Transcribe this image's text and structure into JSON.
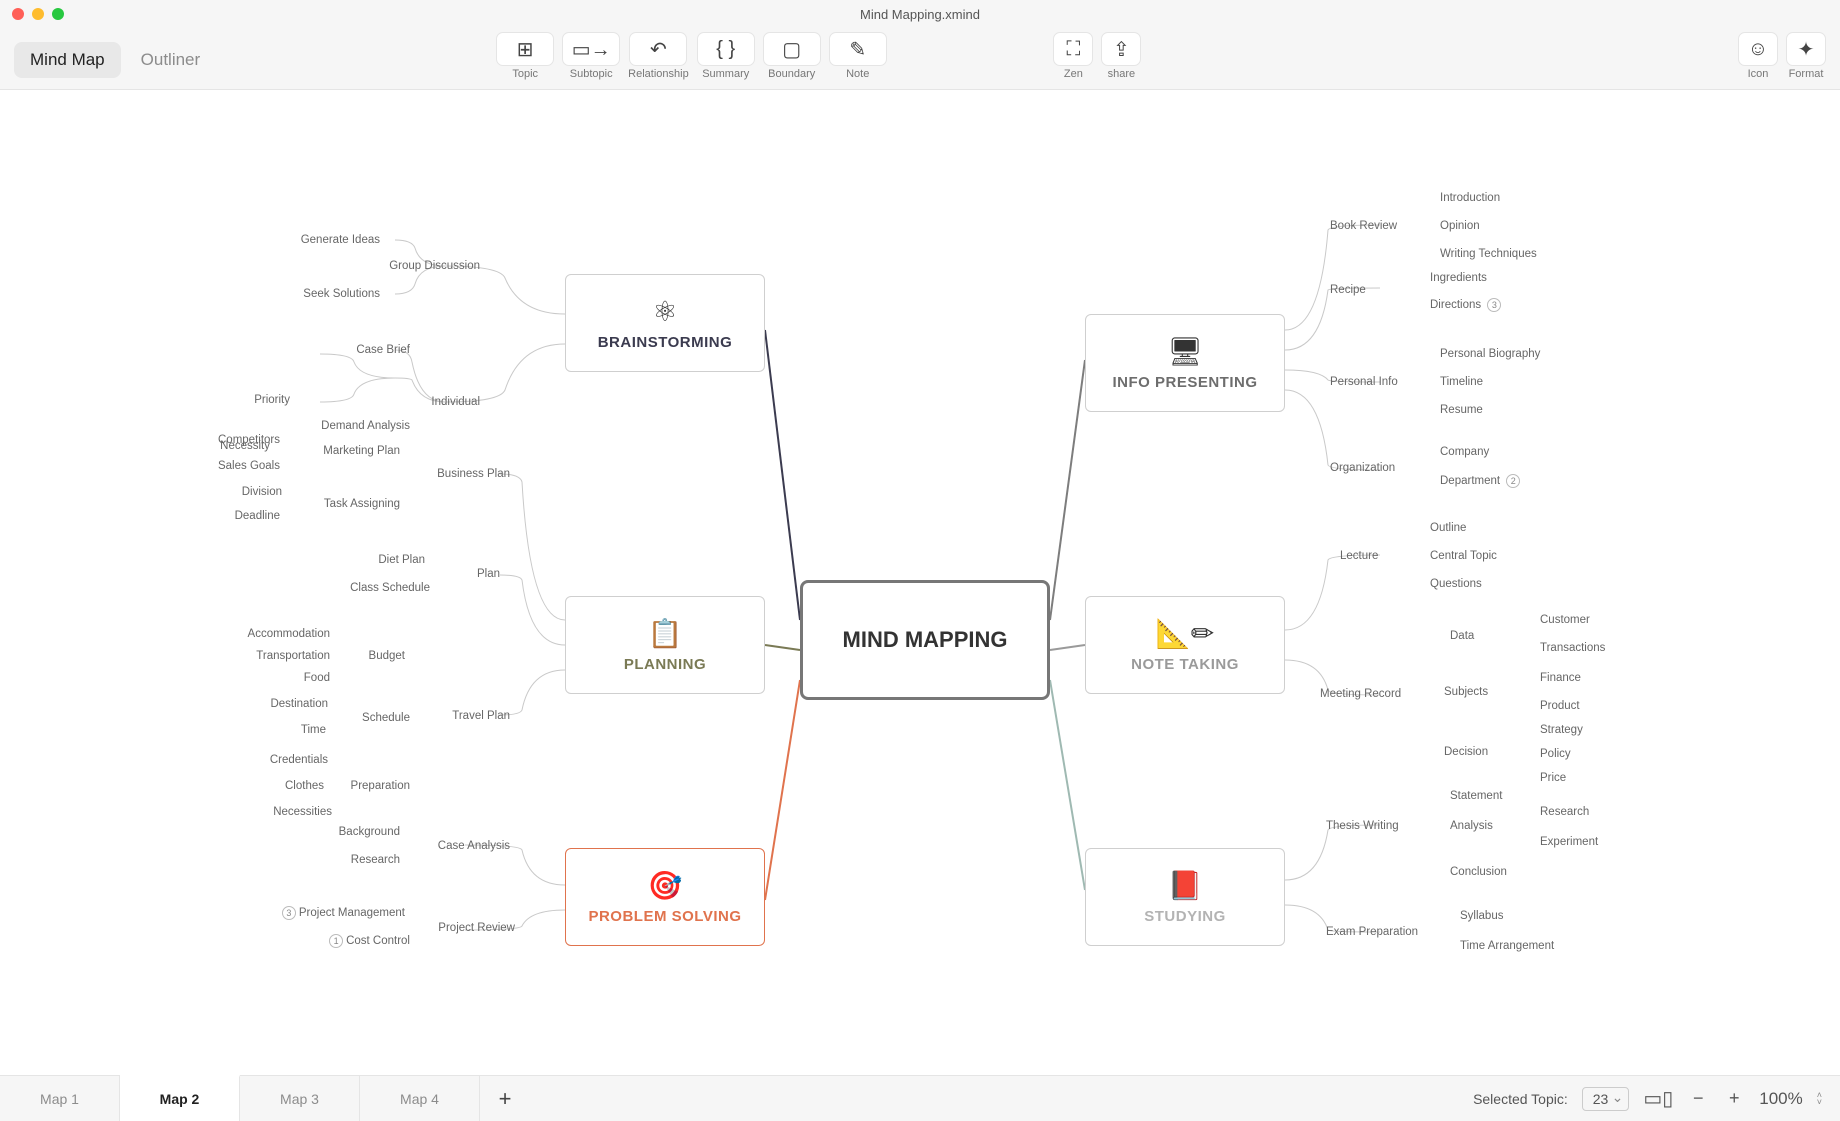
{
  "window": {
    "title": "Mind Mapping.xmind"
  },
  "view_toggle": {
    "mindmap": "Mind Map",
    "outliner": "Outliner",
    "active": "mindmap"
  },
  "toolbar": {
    "topic": "Topic",
    "subtopic": "Subtopic",
    "relationship": "Relationship",
    "summary": "Summary",
    "boundary": "Boundary",
    "note": "Note",
    "zen": "Zen",
    "share": "share",
    "icon": "Icon",
    "format": "Format"
  },
  "central": {
    "title": "MIND MAPPING"
  },
  "branches": {
    "brainstorming": {
      "title": "BRAINSTORMING",
      "color": "#3b3b4f",
      "children": [
        {
          "label": "Group Discussion",
          "children": [
            "Generate Ideas",
            "Seek Solutions"
          ]
        },
        {
          "label": "Individual",
          "children": [
            "Case Brief",
            "Demand Analysis",
            "Priority",
            "Necessity"
          ]
        }
      ]
    },
    "planning": {
      "title": "PLANNING",
      "color": "#7a7a55",
      "children": [
        {
          "label": "Business Plan",
          "children": [
            {
              "label": "Marketing Plan",
              "children": [
                "Competitors",
                "Sales Goals"
              ]
            },
            {
              "label": "Task Assigning",
              "children": [
                "Division",
                "Deadline"
              ]
            }
          ]
        },
        {
          "label": "Plan",
          "children": [
            "Diet Plan",
            "Class Schedule"
          ]
        },
        {
          "label": "Travel Plan",
          "children": [
            {
              "label": "Budget",
              "children": [
                "Accommodation",
                "Transportation",
                "Food"
              ]
            },
            {
              "label": "Schedule",
              "children": [
                "Destination",
                "Time"
              ]
            },
            {
              "label": "Preparation",
              "children": [
                "Credentials",
                "Clothes",
                "Necessities"
              ]
            }
          ]
        }
      ]
    },
    "problem_solving": {
      "title": "PROBLEM SOLVING",
      "color": "#e0734d",
      "children": [
        {
          "label": "Case Analysis",
          "children": [
            "Background",
            "Research"
          ]
        },
        {
          "label": "Project Review",
          "children": [
            "Project Management",
            "Cost Control"
          ],
          "badges": {
            "Project Management": "3",
            "Cost Control": "1"
          }
        }
      ]
    },
    "info_presenting": {
      "title": "INFO PRESENTING",
      "color": "#7d7d7d",
      "children": [
        {
          "label": "Book Review",
          "children": [
            "Introduction",
            "Opinion",
            "Writing Techniques"
          ]
        },
        {
          "label": "Recipe",
          "children": [
            "Ingredients",
            "Directions"
          ],
          "badges": {
            "Directions": "3"
          }
        },
        {
          "label": "Personal Info",
          "children": [
            "Personal Biography",
            "Timeline",
            "Resume"
          ]
        },
        {
          "label": "Organization",
          "children": [
            "Company",
            "Department"
          ],
          "badges": {
            "Department": "2"
          }
        }
      ]
    },
    "note_taking": {
      "title": "NOTE TAKING",
      "color": "#9a9a9a",
      "children": [
        {
          "label": "Lecture",
          "children": [
            "Outline",
            "Central Topic",
            "Questions"
          ]
        },
        {
          "label": "Meeting Record",
          "children": [
            {
              "label": "Data",
              "children": [
                "Customer",
                "Transactions"
              ]
            },
            {
              "label": "Subjects",
              "children": [
                "Finance",
                "Product"
              ]
            },
            {
              "label": "Decision",
              "children": [
                "Strategy",
                "Policy",
                "Price"
              ]
            }
          ]
        }
      ]
    },
    "studying": {
      "title": "STUDYING",
      "color": "#b96a6a",
      "children": [
        {
          "label": "Thesis Writing",
          "children": [
            "Statement",
            "Analysis",
            "Conclusion",
            "Research",
            "Experiment"
          ]
        },
        {
          "label": "Exam Preparation",
          "children": [
            "Syllabus",
            "Time Arrangement"
          ]
        }
      ]
    }
  },
  "tabs": [
    "Map 1",
    "Map 2",
    "Map 3",
    "Map 4"
  ],
  "active_tab": 1,
  "status": {
    "selected_label": "Selected Topic:",
    "selected_count": "23",
    "zoom": "100%"
  }
}
